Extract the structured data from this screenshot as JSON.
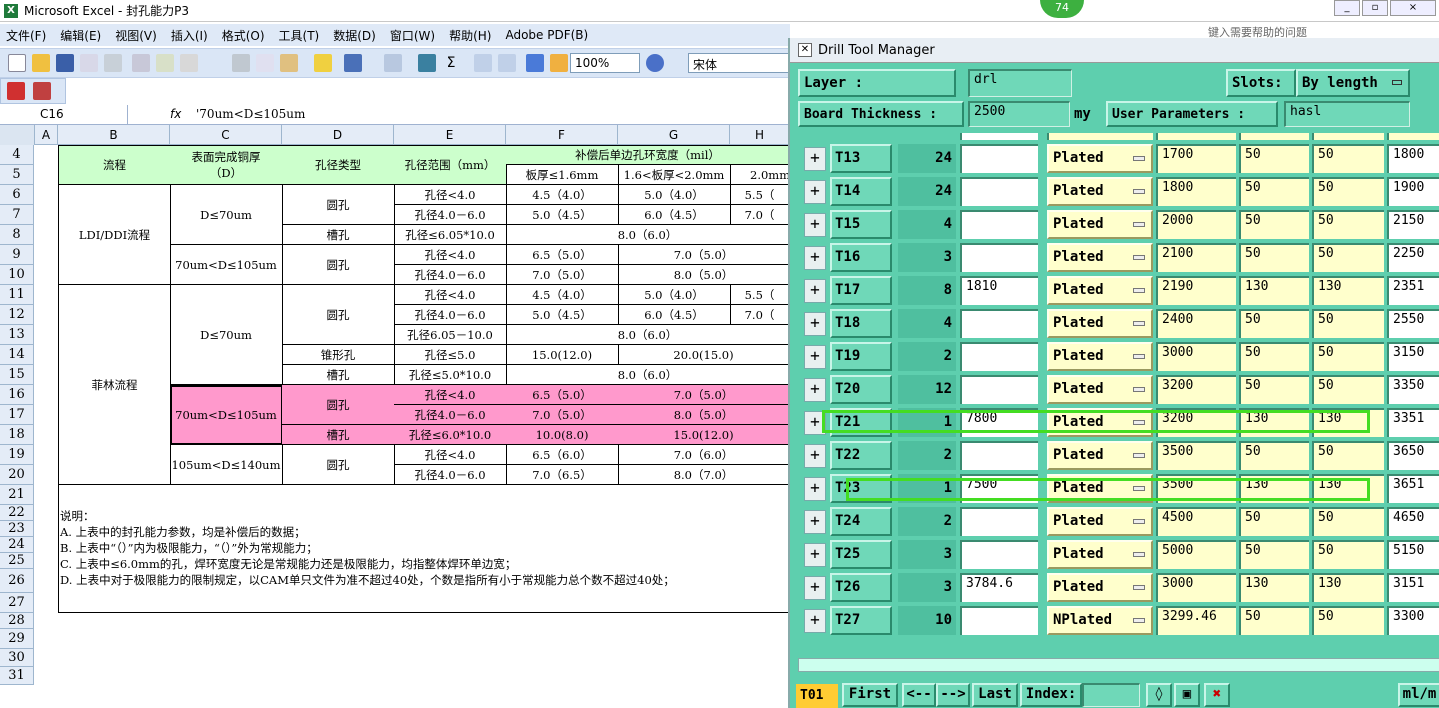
{
  "excel": {
    "title": "Microsoft Excel - 封孔能力P3",
    "menu": [
      "文件(F)",
      "编辑(E)",
      "视图(V)",
      "插入(I)",
      "格式(O)",
      "工具(T)",
      "数据(D)",
      "窗口(W)",
      "帮助(H)",
      "Adobe PDF(B)"
    ],
    "zoom": "100%",
    "font": "宋体",
    "help_placeholder": "键入需要帮助的问题",
    "name_box": "C16",
    "fx": "fx",
    "formula": "'70um<D≤105um",
    "columns": [
      "A",
      "B",
      "C",
      "D",
      "E",
      "F",
      "G",
      "H"
    ],
    "rows": [
      "4",
      "5",
      "6",
      "7",
      "8",
      "9",
      "10",
      "11",
      "12",
      "13",
      "14",
      "15",
      "16",
      "17",
      "18",
      "19",
      "20",
      "21",
      "22",
      "23",
      "24",
      "25",
      "26",
      "27",
      "28",
      "29",
      "30",
      "31"
    ],
    "header": {
      "process": "流程",
      "copper_line1": "表面完成铜厚",
      "copper_line2": "（D）",
      "hole_type": "孔径类型",
      "hole_range": "孔径范围（mm）",
      "ring_width": "补偿后单边孔环宽度（mil）",
      "f5": "板厚≤1.6mm",
      "g5": "1.6<板厚<2.0mm",
      "h5": "2.0mm"
    },
    "cells": {
      "ldi": "LDI/DDI流程",
      "felin": "菲林流程",
      "d70": "D≤70um",
      "d70_105": "70um<D≤105um",
      "d105_140": "105um<D≤140um",
      "round": "圆孔",
      "slot": "槽孔",
      "cone": "锥形孔",
      "r6_e": "孔径<4.0",
      "r6_f": "4.5（4.0）",
      "r6_g": "5.0（4.0）",
      "r6_h": "5.5（",
      "r7_e": "孔径4.0－6.0",
      "r7_f": "5.0（4.5）",
      "r7_g": "6.0（4.5）",
      "r7_h": "7.0（",
      "r8_e": "孔径≤6.05*10.0",
      "r8_fg": "8.0（6.0）",
      "r9_e": "孔径<4.0",
      "r9_f": "6.5（5.0）",
      "r9_g": "7.0（5.0）",
      "r10_e": "孔径4.0－6.0",
      "r10_f": "7.0（5.0）",
      "r10_g": "8.0（5.0）",
      "r11_e": "孔径<4.0",
      "r11_f": "4.5（4.0）",
      "r11_g": "5.0（4.0）",
      "r11_h": "5.5（",
      "r12_e": "孔径4.0－6.0",
      "r12_f": "5.0（4.5）",
      "r12_g": "6.0（4.5）",
      "r12_h": "7.0（",
      "r13_e": "孔径6.05－10.0",
      "r13_fg": "8.0（6.0）",
      "r14_e": "孔径≤5.0",
      "r14_f": "15.0(12.0)",
      "r14_g": "20.0(15.0)",
      "r15_e": "孔径≤5.0*10.0",
      "r15_fg": "8.0（6.0）",
      "r16_e": "孔径<4.0",
      "r16_f": "6.5（5.0）",
      "r16_g": "7.0（5.0）",
      "r17_e": "孔径4.0－6.0",
      "r17_f": "7.0（5.0）",
      "r17_g": "8.0（5.0）",
      "r18_e": "孔径≤6.0*10.0",
      "r18_f": "10.0(8.0)",
      "r18_g": "15.0(12.0)",
      "r19_e": "孔径<4.0",
      "r19_f": "6.5（6.0）",
      "r19_g": "7.0（6.0）",
      "r20_e": "孔径4.0－6.0",
      "r20_f": "7.0（6.5）",
      "r20_g": "8.0（7.0）"
    },
    "notes": [
      "说明：",
      "A. 上表中的封孔能力参数，均是补偿后的数据；",
      "B. 上表中“（）”内为极限能力，“（）”外为常规能力；",
      "C. 上表中≤6.0mm的孔，焊环宽度无论是常规能力还是极限能力，均指整体焊环单边宽；",
      "D. 上表中对于极限能力的限制规定，以CAM单只文件为准不超过40处，个数是指所有小于常规能力总个数不超过40处；"
    ]
  },
  "badge": "74",
  "drill": {
    "title": "Drill Tool Manager",
    "layer_label": "Layer        :",
    "layer_value": "drl",
    "slots_label": "Slots:",
    "slots_value": "By length",
    "board_label": "Board Thickness :",
    "board_value": "2500",
    "board_unit": "my",
    "user_label": "User Parameters :",
    "user_value": "hasl",
    "rows": [
      {
        "name": "T13",
        "count": "24",
        "size": "",
        "type": "Plated",
        "a": "1700",
        "b": "50",
        "c": "50",
        "d": "1800"
      },
      {
        "name": "T14",
        "count": "24",
        "size": "",
        "type": "Plated",
        "a": "1800",
        "b": "50",
        "c": "50",
        "d": "1900"
      },
      {
        "name": "T15",
        "count": "4",
        "size": "",
        "type": "Plated",
        "a": "2000",
        "b": "50",
        "c": "50",
        "d": "2150"
      },
      {
        "name": "T16",
        "count": "3",
        "size": "",
        "type": "Plated",
        "a": "2100",
        "b": "50",
        "c": "50",
        "d": "2250"
      },
      {
        "name": "T17",
        "count": "8",
        "size": "1810",
        "type": "Plated",
        "a": "2190",
        "b": "130",
        "c": "130",
        "d": "2351"
      },
      {
        "name": "T18",
        "count": "4",
        "size": "",
        "type": "Plated",
        "a": "2400",
        "b": "50",
        "c": "50",
        "d": "2550"
      },
      {
        "name": "T19",
        "count": "2",
        "size": "",
        "type": "Plated",
        "a": "3000",
        "b": "50",
        "c": "50",
        "d": "3150"
      },
      {
        "name": "T20",
        "count": "12",
        "size": "",
        "type": "Plated",
        "a": "3200",
        "b": "50",
        "c": "50",
        "d": "3350"
      },
      {
        "name": "T21",
        "count": "1",
        "size": "7800",
        "type": "Plated",
        "a": "3200",
        "b": "130",
        "c": "130",
        "d": "3351"
      },
      {
        "name": "T22",
        "count": "2",
        "size": "",
        "type": "Plated",
        "a": "3500",
        "b": "50",
        "c": "50",
        "d": "3650"
      },
      {
        "name": "T23",
        "count": "1",
        "size": "7500",
        "type": "Plated",
        "a": "3500",
        "b": "130",
        "c": "130",
        "d": "3651"
      },
      {
        "name": "T24",
        "count": "2",
        "size": "",
        "type": "Plated",
        "a": "4500",
        "b": "50",
        "c": "50",
        "d": "4650"
      },
      {
        "name": "T25",
        "count": "3",
        "size": "",
        "type": "Plated",
        "a": "5000",
        "b": "50",
        "c": "50",
        "d": "5150"
      },
      {
        "name": "T26",
        "count": "3",
        "size": "3784.6",
        "type": "Plated",
        "a": "3000",
        "b": "130",
        "c": "130",
        "d": "3151"
      },
      {
        "name": "T27",
        "count": "10",
        "size": "",
        "type": "NPlated",
        "a": "3299.46",
        "b": "50",
        "c": "50",
        "d": "3300"
      }
    ],
    "bottom": {
      "current": "T01",
      "first": "First",
      "prev": "<--",
      "next": "-->",
      "last": "Last",
      "index_label": "Index:",
      "units": "ml/m"
    }
  },
  "colors": {
    "accent_green": "#44dd22",
    "teal": "#5ecfae",
    "header_green": "#ccffcc",
    "pink": "#ff99cc"
  }
}
